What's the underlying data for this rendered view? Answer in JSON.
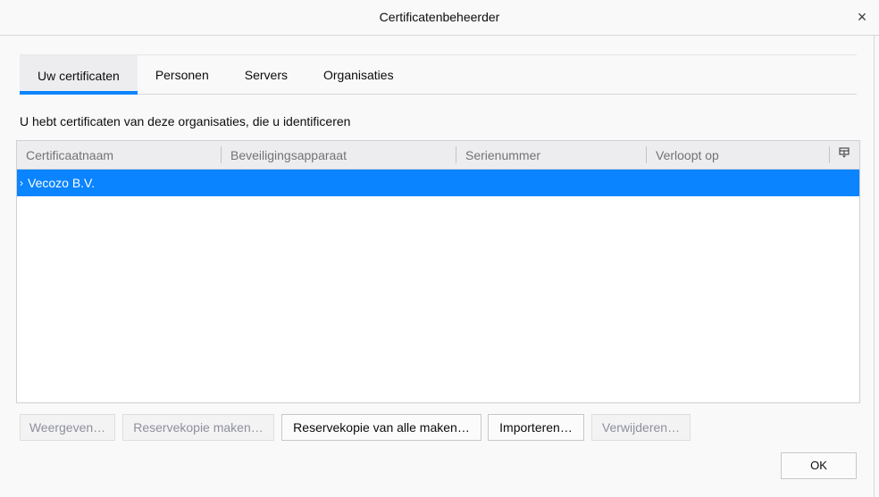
{
  "window": {
    "title": "Certificatenbeheerder",
    "close_glyph": "×"
  },
  "tabs": [
    {
      "label": "Uw certificaten",
      "active": true
    },
    {
      "label": "Personen",
      "active": false
    },
    {
      "label": "Servers",
      "active": false
    },
    {
      "label": "Organisaties",
      "active": false
    }
  ],
  "description": "U hebt certificaten van deze organisaties, die u identificeren",
  "table": {
    "columns": [
      "Certificaatnaam",
      "Beveiligingsapparaat",
      "Serienummer",
      "Verloopt op"
    ],
    "column_picker_icon": "column-picker-icon",
    "rows": [
      {
        "label": "Vecozo B.V.",
        "twisty": "›",
        "selected": true
      }
    ]
  },
  "buttons": {
    "view": "Weergeven…",
    "backup": "Reservekopie maken…",
    "backup_all": "Reservekopie van alle maken…",
    "import": "Importeren…",
    "delete": "Verwijderen…",
    "ok": "OK"
  },
  "colors": {
    "accent": "#0a84ff",
    "tab_active_bg": "#ededf0",
    "disabled_text": "#8f8f9d"
  }
}
